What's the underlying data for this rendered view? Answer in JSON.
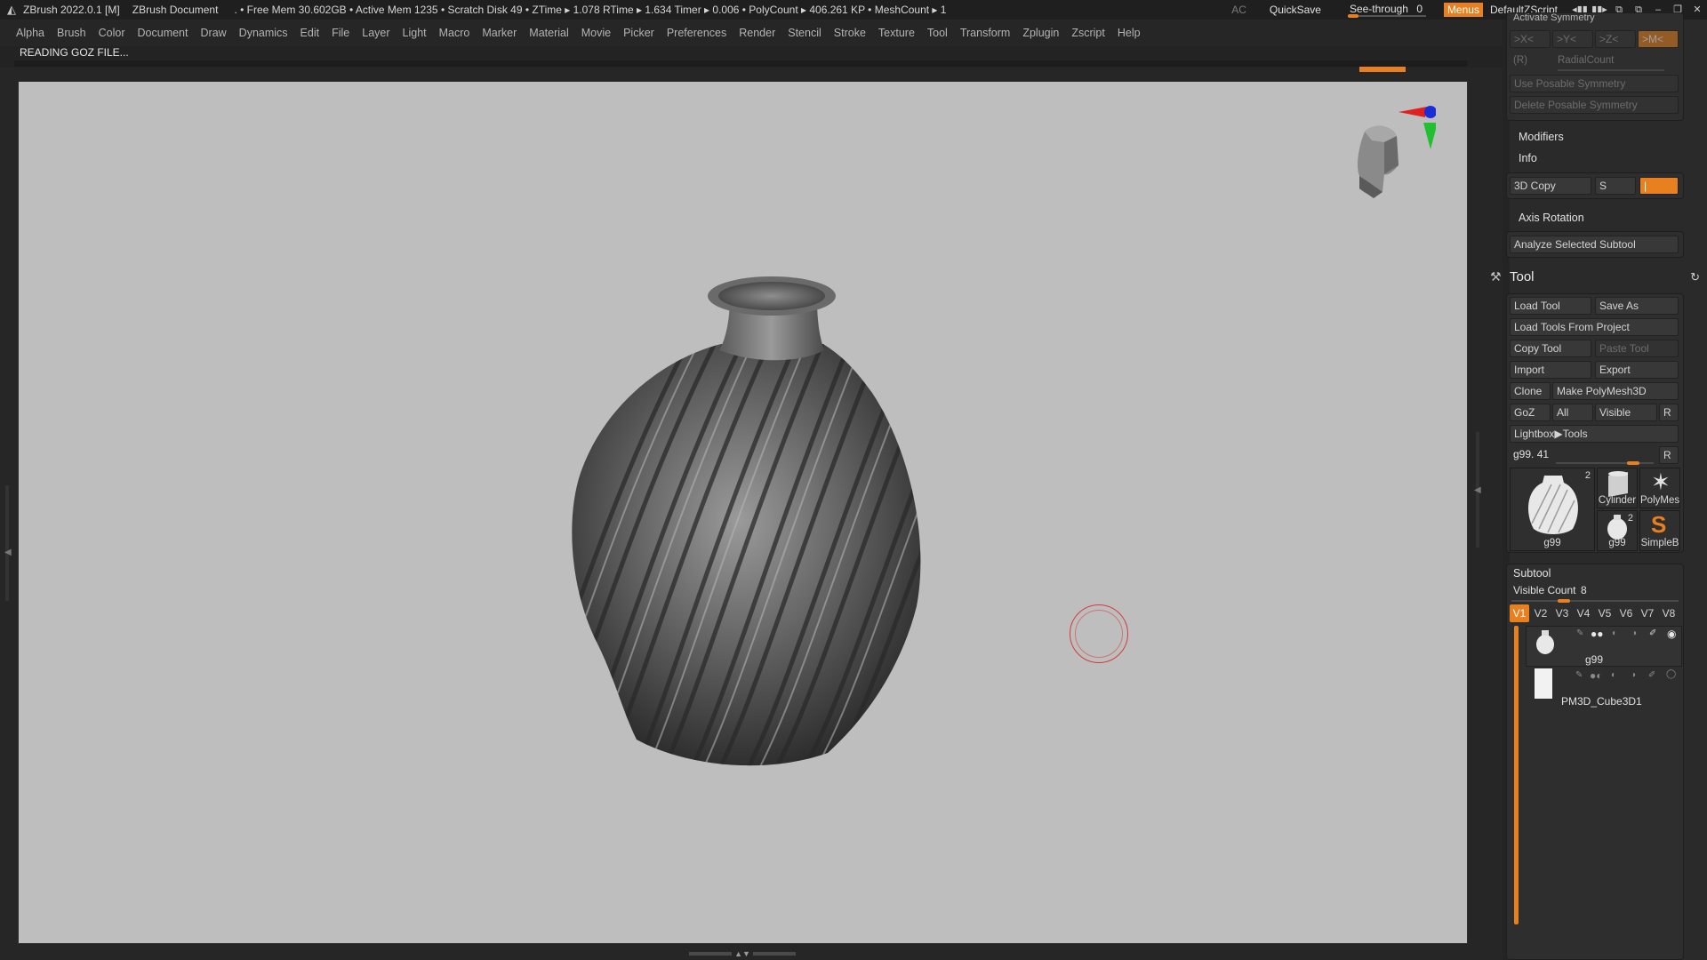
{
  "titlebar": {
    "app": "ZBrush 2022.0.1 [M]",
    "document": "ZBrush Document",
    "stats": ". • Free Mem 30.602GB • Active Mem 1235 • Scratch Disk 49 •  ZTime ▸ 1.078 RTime ▸ 1.634 Timer ▸ 0.006 • PolyCount ▸ 406.261 KP  • MeshCount ▸ 1",
    "ac": "AC",
    "quicksave": "QuickSave",
    "seethrough_label": "See-through",
    "seethrough_value": "0",
    "menus": "Menus",
    "script": "DefaultZScript"
  },
  "menubar": [
    "Alpha",
    "Brush",
    "Color",
    "Document",
    "Draw",
    "Dynamics",
    "Edit",
    "File",
    "Layer",
    "Light",
    "Macro",
    "Marker",
    "Material",
    "Movie",
    "Picker",
    "Preferences",
    "Render",
    "Stencil",
    "Stroke",
    "Texture",
    "Tool",
    "Transform",
    "Zplugin",
    "Zscript",
    "Help"
  ],
  "status": {
    "message": "READING GOZ FILE..."
  },
  "tray": {
    "activate_symmetry": "Activate Symmetry",
    "sym_x": ">X<",
    "sym_y": ">Y<",
    "sym_z": ">Z<",
    "sym_m": ">M<",
    "radial_r": "(R)",
    "radial_count": "RadialCount",
    "use_posable": "Use Posable Symmetry",
    "delete_posable": "Delete Posable Symmetry",
    "modifiers": "Modifiers",
    "info": "Info",
    "copy3d": "3D Copy",
    "copy3d_s": "S",
    "axis_rotation": "Axis Rotation",
    "analyze": "Analyze Selected Subtool",
    "tool_title": "Tool",
    "load_tool": "Load Tool",
    "save_as": "Save As",
    "load_from_project": "Load Tools From Project",
    "copy_tool": "Copy Tool",
    "paste_tool": "Paste Tool",
    "import": "Import",
    "export": "Export",
    "clone": "Clone",
    "make_polymesh": "Make PolyMesh3D",
    "goz": "GoZ",
    "all": "All",
    "visible": "Visible",
    "r": "R",
    "lightbox_tools": "Lightbox▶Tools",
    "current_tool": "g99. 41",
    "thumbs": [
      {
        "name": "g99",
        "count": "2"
      },
      {
        "name": "Cylinder"
      },
      {
        "name": "PolyMes"
      },
      {
        "name": "g99",
        "count": "2"
      },
      {
        "name": "SimpleB"
      }
    ],
    "subtool": "Subtool",
    "visible_count_label": "Visible Count",
    "visible_count": "8",
    "vtabs": [
      "V1",
      "V2",
      "V3",
      "V4",
      "V5",
      "V6",
      "V7",
      "V8"
    ],
    "subtools": [
      {
        "name": "g99"
      },
      {
        "name": "PM3D_Cube3D1"
      }
    ]
  },
  "colors": {
    "accent": "#e8801f",
    "canvas": "#bebebe",
    "panel": "#2a2a2a"
  },
  "icons": [
    "zbrush-logo-icon",
    "hammer-icon",
    "refresh-icon",
    "eye-icon",
    "brush-pen-icon",
    "window-minimize-icon",
    "window-restore-icon",
    "window-close-icon"
  ]
}
